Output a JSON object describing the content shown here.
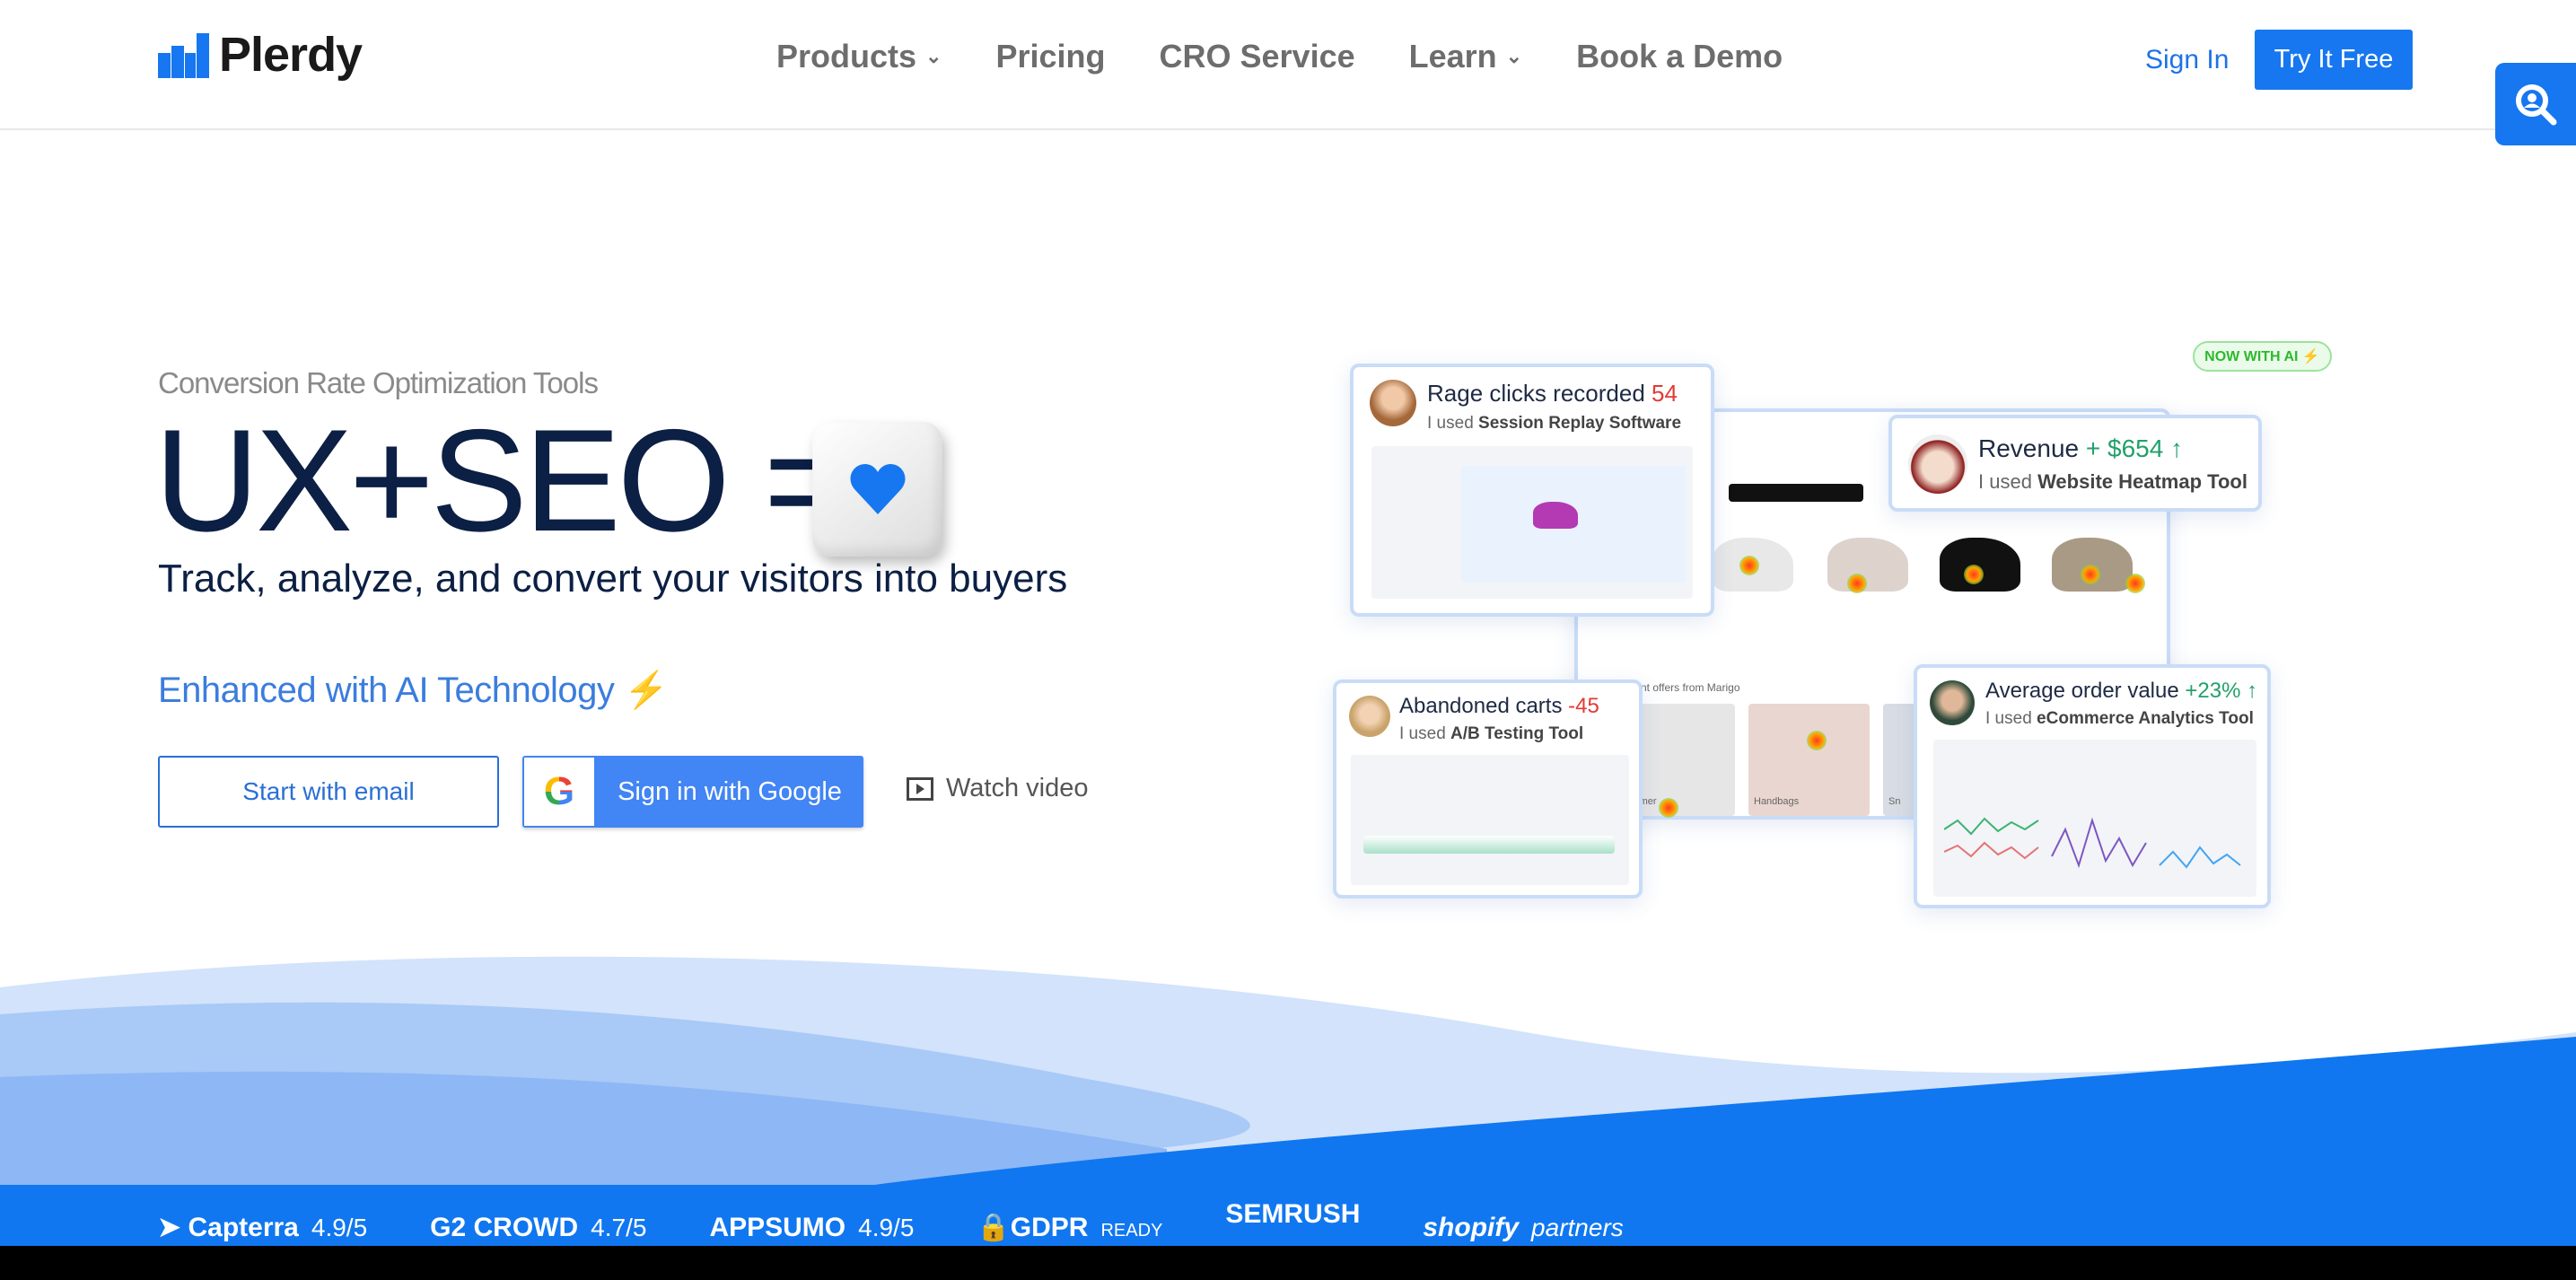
{
  "header": {
    "logo_text": "Plerdy",
    "nav": [
      {
        "label": "Products",
        "dropdown": true
      },
      {
        "label": "Pricing"
      },
      {
        "label": "CRO Service"
      },
      {
        "label": "Learn",
        "dropdown": true
      },
      {
        "label": "Book a Demo"
      }
    ],
    "sign_in": "Sign In",
    "try_free": "Try It Free"
  },
  "hero": {
    "subtitle": "Conversion Rate Optimization Tools",
    "headline": "UX+SEO =",
    "tagline": "Track, analyze, and convert your visitors into buyers",
    "enhanced": "Enhanced with AI Technology",
    "enhanced_icon": "lightning-icon",
    "start_email": "Start with email",
    "google_signin": "Sign in with Google",
    "watch_video": "Watch video"
  },
  "visuals": {
    "ai_badge": "NOW WITH AI ⚡",
    "cards": [
      {
        "title": "Rage clicks recorded",
        "value": "54",
        "value_color": "#e53935",
        "prefix": "I used",
        "tool": "Session Replay Software"
      },
      {
        "title": "Revenue",
        "value": "+ $654 ↑",
        "value_color": "#22a06b",
        "prefix": "I used",
        "tool": "Website Heatmap Tool"
      },
      {
        "title": "Abandoned carts",
        "value": "-45",
        "value_color": "#e53935",
        "prefix": "I used",
        "tool": "A/B Testing Tool"
      },
      {
        "title": "Average order value",
        "value": "+23% ↑",
        "value_color": "#22a06b",
        "prefix": "I used",
        "tool": "eCommerce Analytics Tool"
      }
    ],
    "shop": {
      "offers_title": "Current offers from Marigo",
      "categories": [
        "Summer",
        "Handbags",
        "Sn"
      ]
    }
  },
  "trust": [
    {
      "name": "Capterra",
      "rating": "4.9/5"
    },
    {
      "name": "G2 CROWD",
      "rating": "4.7/5"
    },
    {
      "name": "APPSUMO",
      "rating": "4.9/5"
    },
    {
      "name": "GDPR",
      "rating": "READY"
    },
    {
      "name": "SEMRUSH",
      "rating": ""
    },
    {
      "name": "shopify",
      "rating": "partners"
    }
  ],
  "colors": {
    "brand": "#1677f0",
    "headline": "#0c1f44",
    "accent_text": "#3b7ddd"
  }
}
